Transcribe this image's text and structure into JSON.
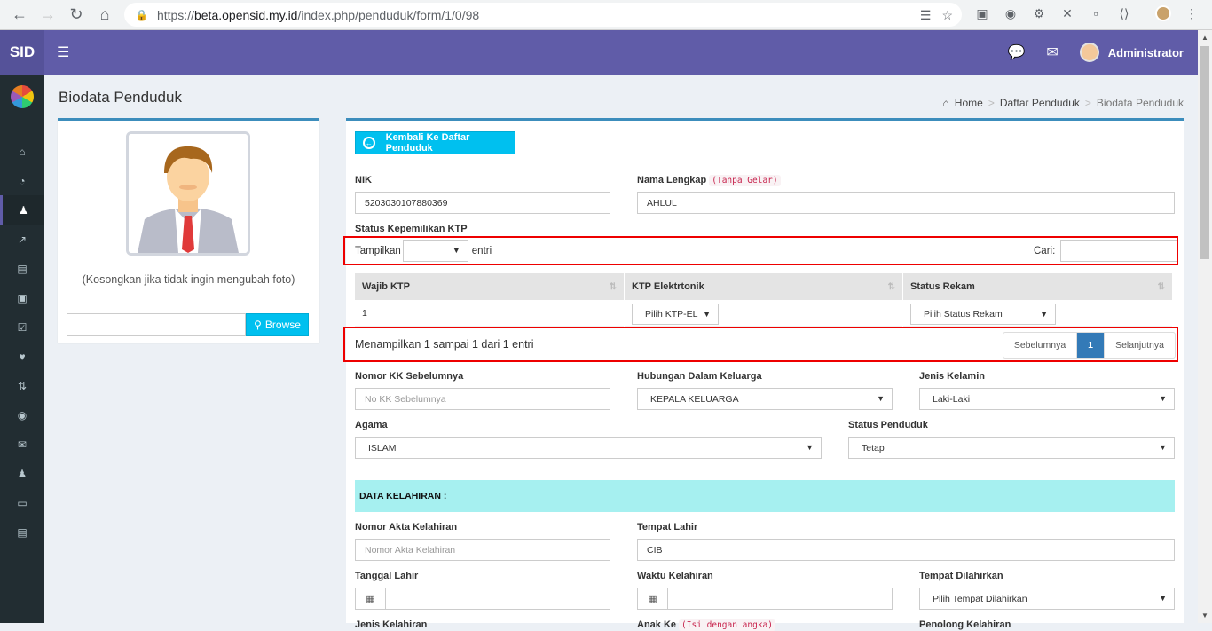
{
  "browser": {
    "url_prefix": "https://",
    "url_host": "beta.opensid.my.id",
    "url_path": "/index.php/penduduk/form/1/0/98"
  },
  "topbar": {
    "logo": "SID",
    "user_name": "Administrator"
  },
  "header": {
    "title": "Biodata Penduduk",
    "breadcrumb": [
      "Home",
      "Daftar Penduduk",
      "Biodata Penduduk"
    ]
  },
  "photo_panel": {
    "hint": "(Kosongkan jika tidak ingin mengubah foto)",
    "browse_label": "Browse"
  },
  "form": {
    "back_label": "Kembali Ke Daftar Penduduk",
    "nik": {
      "label": "NIK",
      "value": "5203030107880369"
    },
    "nama": {
      "label": "Nama Lengkap",
      "hint": "(Tanpa Gelar)",
      "value": "AHLUL"
    },
    "ktp_status_label": "Status Kepemilikan KTP",
    "dt_length_label": "Tampilkan",
    "dt_length_suffix": "entri",
    "dt_search_label": "Cari:",
    "table": {
      "columns": [
        "Wajib KTP",
        "KTP Elektrtonik",
        "Status Rekam"
      ],
      "row": {
        "wajib": "1",
        "ktp_el": "Pilih KTP-EL",
        "status_rekam": "Pilih Status Rekam"
      }
    },
    "dt_info": "Menampilkan 1 sampai 1 dari 1 entri",
    "pager": {
      "prev": "Sebelumnya",
      "page": "1",
      "next": "Selanjutnya"
    },
    "no_kk": {
      "label": "Nomor KK Sebelumnya",
      "placeholder": "No KK Sebelumnya"
    },
    "hubungan": {
      "label": "Hubungan Dalam Keluarga",
      "value": "KEPALA KELUARGA"
    },
    "jenis_kelamin": {
      "label": "Jenis Kelamin",
      "value": "Laki-Laki"
    },
    "agama": {
      "label": "Agama",
      "value": "ISLAM"
    },
    "status_penduduk": {
      "label": "Status Penduduk",
      "value": "Tetap"
    },
    "section_kelahiran": "DATA KELAHIRAN :",
    "akta": {
      "label": "Nomor Akta Kelahiran",
      "placeholder": "Nomor Akta Kelahiran"
    },
    "tempat_lahir": {
      "label": "Tempat Lahir",
      "value": "CIB"
    },
    "tanggal_lahir": {
      "label": "Tanggal Lahir"
    },
    "waktu_kelahiran": {
      "label": "Waktu Kelahiran"
    },
    "tempat_dilahirkan": {
      "label": "Tempat Dilahirkan",
      "value": "Pilih Tempat Dilahirkan"
    },
    "jenis_kelahiran": {
      "label": "Jenis Kelahiran"
    },
    "anak_ke": {
      "label": "Anak Ke",
      "hint": "(Isi dengan angka)"
    },
    "penolong": {
      "label": "Penolong Kelahiran"
    }
  }
}
